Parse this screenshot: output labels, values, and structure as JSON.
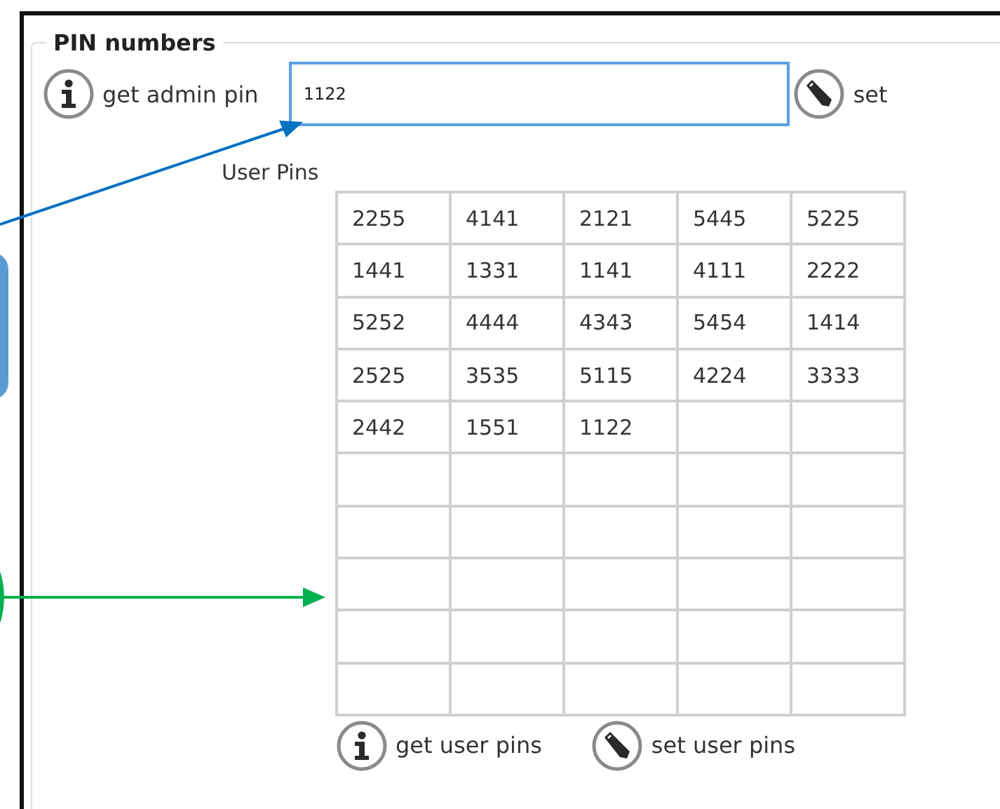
{
  "group": {
    "title": "PIN numbers"
  },
  "admin_pin": {
    "get_label": "get admin pin",
    "value": "1122",
    "set_label": "set"
  },
  "user_pins": {
    "label": "User Pins",
    "rows": [
      [
        "2255",
        "4141",
        "2121",
        "5445",
        "5225"
      ],
      [
        "1441",
        "1331",
        "1141",
        "4111",
        "2222"
      ],
      [
        "5252",
        "4444",
        "4343",
        "5454",
        "1414"
      ],
      [
        "2525",
        "3535",
        "5115",
        "4224",
        "3333"
      ],
      [
        "2442",
        "1551",
        "1122"
      ]
    ],
    "get_label": "get user pins",
    "set_label": "set user pins"
  }
}
